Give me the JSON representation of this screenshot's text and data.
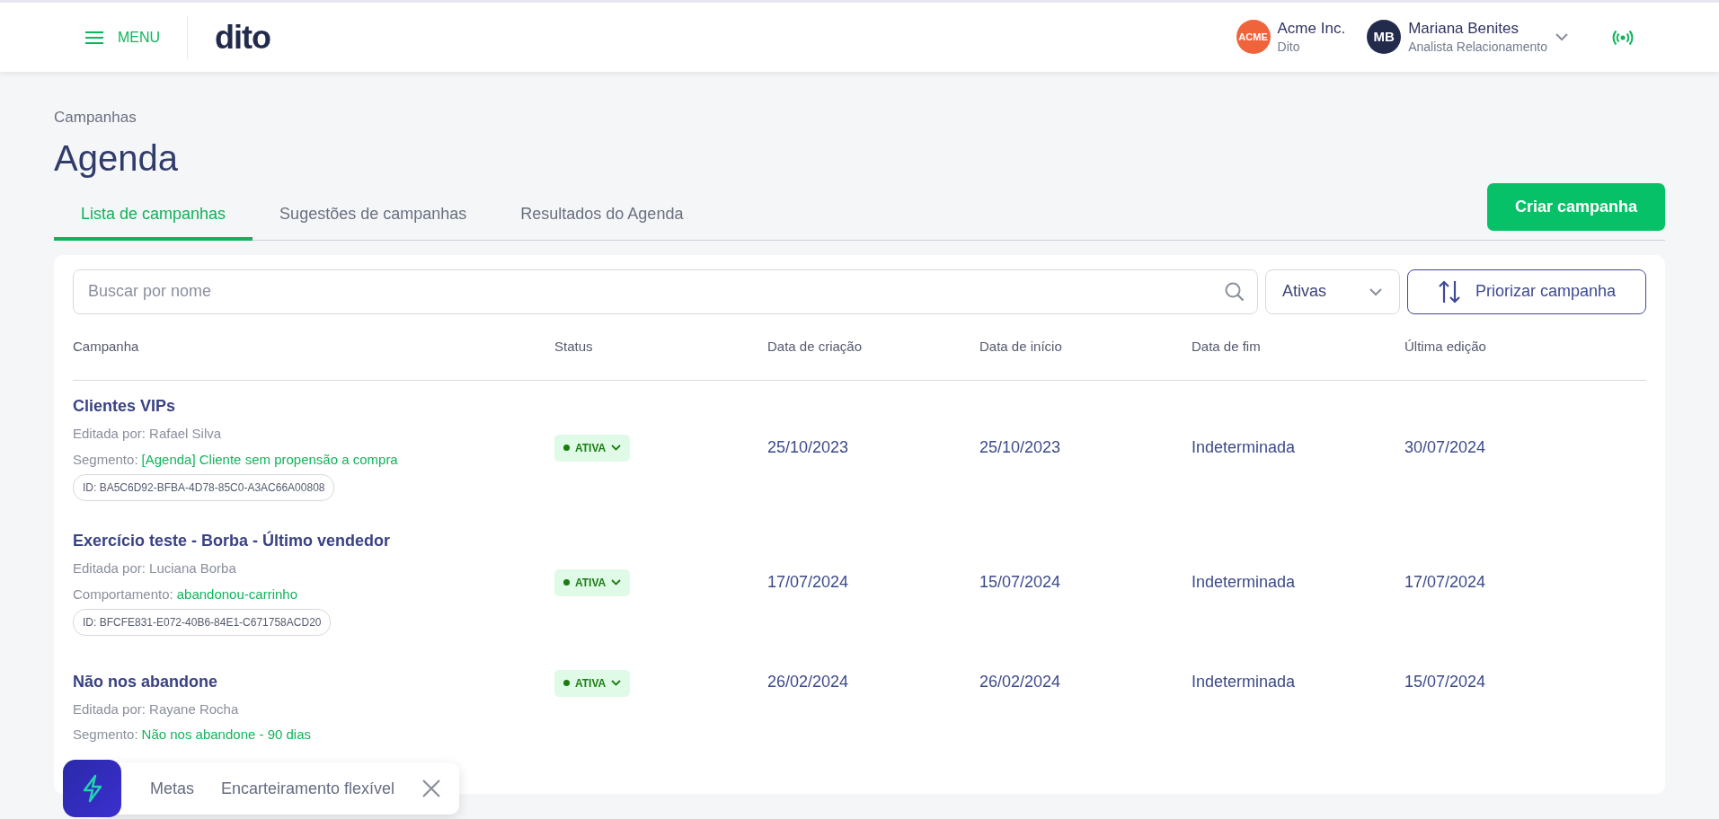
{
  "header": {
    "menu_label": "MENU",
    "logo": "dito",
    "company": {
      "avatar": "ACME",
      "name": "Acme Inc.",
      "sub": "Dito"
    },
    "user": {
      "initials": "MB",
      "name": "Mariana Benites",
      "role": "Analista Relacionamento"
    }
  },
  "breadcrumb": "Campanhas",
  "title": "Agenda",
  "tabs": [
    {
      "label": "Lista de campanhas",
      "selected": true
    },
    {
      "label": "Sugestões de campanhas",
      "selected": false
    },
    {
      "label": "Resultados do Agenda",
      "selected": false
    }
  ],
  "create_button": "Criar campanha",
  "search": {
    "placeholder": "Buscar por nome"
  },
  "filter": {
    "value": "Ativas"
  },
  "prioritize_button": "Priorizar campanha",
  "table": {
    "columns": [
      "Campanha",
      "Status",
      "Data de criação",
      "Data de início",
      "Data de fim",
      "Última edição"
    ],
    "rows": [
      {
        "name": "Clientes VIPs",
        "edited_by": "Editada por: Rafael Silva",
        "criterion_label": "Segmento:",
        "criterion_value": "[Agenda] Cliente sem propensão a compra",
        "id": "ID: BA5C6D92-BFBA-4D78-85C0-A3AC66A00808",
        "status": "ATIVA",
        "created": "25/10/2023",
        "start": "25/10/2023",
        "end": "Indeterminada",
        "last_edit": "30/07/2024"
      },
      {
        "name": "Exercício teste - Borba - Último vendedor",
        "edited_by": "Editada por: Luciana Borba",
        "criterion_label": "Comportamento:",
        "criterion_value": "abandonou-carrinho",
        "id": "ID: BFCFE831-E072-40B6-84E1-C671758ACD20",
        "status": "ATIVA",
        "created": "17/07/2024",
        "start": "15/07/2024",
        "end": "Indeterminada",
        "last_edit": "17/07/2024"
      },
      {
        "name": "Não nos abandone",
        "edited_by": "Editada por: Rayane Rocha",
        "criterion_label": "Segmento:",
        "criterion_value": "Não nos abandone - 90 dias",
        "status": "ATIVA",
        "created": "26/02/2024",
        "start": "26/02/2024",
        "end": "Indeterminada",
        "last_edit": "15/07/2024"
      }
    ]
  },
  "popup": {
    "items": [
      "Metas",
      "Encarteiramento flexível"
    ]
  }
}
